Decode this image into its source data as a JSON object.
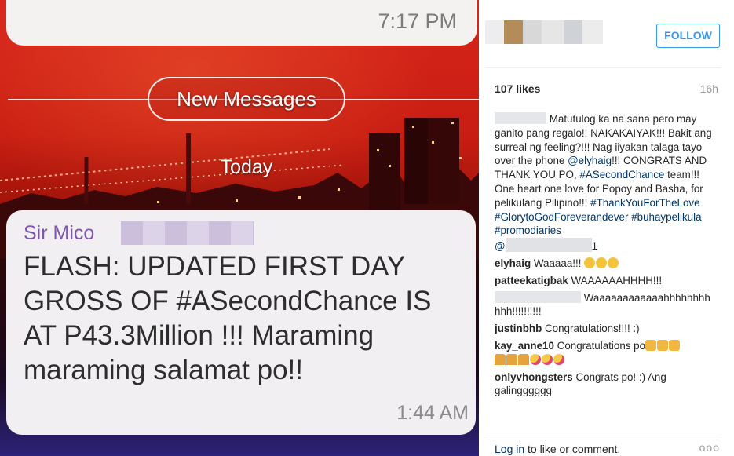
{
  "photo": {
    "time_top": "7:17 PM",
    "new_messages": "New Messages",
    "today": "Today",
    "sender": "Sir Mico",
    "message": "FLASH: UPDATED FIRST DAY GROSS OF #ASecondChance IS AT P43.3Million !!! Maraming maraming salamat po!!",
    "time_msg": "1:44 AM"
  },
  "panel": {
    "follow_label": "FOLLOW",
    "likes": "107 likes",
    "age": "16h",
    "caption": {
      "text1": "Matutulog ka na sana pero may ganito pang regalo!! NAKAKAIYAK!!! Bakit ang surreal ng feeling?!!! Nag iiyakan talaga tayo over the phone ",
      "mention1": "@elyhaig",
      "text2": "!!! CONGRATS AND THANK YOU PO, ",
      "tag1": "#ASecondChance",
      "text3": " team!!! One heart one love for Popoy and Basha, for pelikulang Pilipino!!! ",
      "tag2": "#ThankYouForTheLove",
      "tag3": "#GlorytoGodForeverandever",
      "tag4": "#buhaypelikula",
      "tag5": "#promodiaries",
      "mention2_prefix": "@",
      "mention2_suffix": "1"
    },
    "comments": [
      {
        "user": "elyhaig",
        "text": "Waaaaa!!!"
      },
      {
        "user": "patteekatigbak",
        "text": "WAAAAAAHHHH!!!"
      },
      {
        "user": "",
        "text": "Waaaaaaaaaaaahhhhhhhh hhh!!!!!!!!!!"
      },
      {
        "user": "justinbhb",
        "text": "Congratulations!!!! :)"
      },
      {
        "user": "kay_anne10",
        "text": "Congratulations po"
      },
      {
        "user": "onlyvhongsters",
        "text": "Congrats po! :) Ang galingggggg"
      }
    ],
    "login_link": "Log in",
    "login_rest": " to like or comment.",
    "more": "ooo"
  },
  "colors": {
    "accent": "#3897f0",
    "link": "#003569",
    "sender": "#8057a8"
  }
}
